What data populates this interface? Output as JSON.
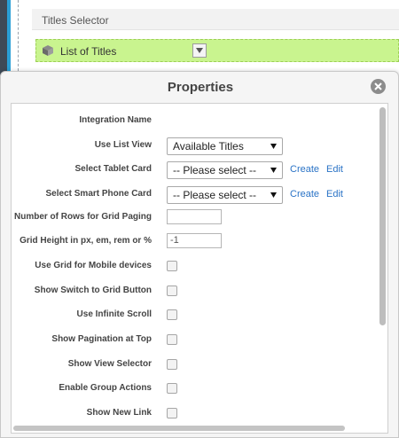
{
  "background": {
    "selector_title": "Titles Selector",
    "list_item_label": "List of Titles",
    "list_item_icon": "cube-icon"
  },
  "dialog": {
    "title": "Properties",
    "close_icon": "close-icon"
  },
  "fields": {
    "integration_name": {
      "label": "Integration Name"
    },
    "use_list_view": {
      "label": "Use List View",
      "value": "Available Titles"
    },
    "tablet_card": {
      "label": "Select Tablet Card",
      "value": "-- Please select --",
      "create": "Create",
      "edit": "Edit"
    },
    "phone_card": {
      "label": "Select Smart Phone Card",
      "value": "-- Please select --",
      "create": "Create",
      "edit": "Edit"
    },
    "rows_grid_paging": {
      "label": "Number of Rows for Grid Paging",
      "value": ""
    },
    "grid_height": {
      "label": "Grid Height in px, em, rem or %",
      "value": "-1"
    },
    "grid_mobile": {
      "label": "Use Grid for Mobile devices",
      "checked": false
    },
    "switch_grid": {
      "label": "Show Switch to Grid Button",
      "checked": false
    },
    "infinite_scroll": {
      "label": "Use Infinite Scroll",
      "checked": false
    },
    "pagination_top": {
      "label": "Show Pagination at Top",
      "checked": false
    },
    "view_selector": {
      "label": "Show View Selector",
      "checked": false
    },
    "group_actions": {
      "label": "Enable Group Actions",
      "checked": false
    },
    "new_link": {
      "label": "Show New Link",
      "checked": false
    }
  },
  "colors": {
    "accent_bar": "#c9f48f",
    "link": "#2a73c6",
    "sidebar_blue": "#2a9fd6"
  }
}
